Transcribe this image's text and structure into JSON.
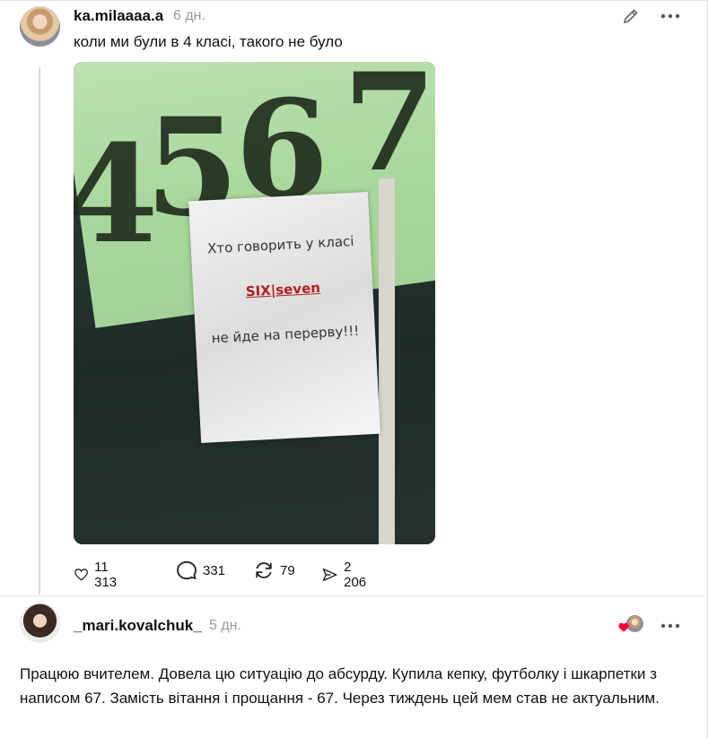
{
  "post": {
    "username": "ka.milaaaa.a",
    "time": "6 дн.",
    "text": "коли ми були в 4 класі, такого не було",
    "image": {
      "sheet_line1": "Хто говорить у класі",
      "sheet_line2": "SIX|seven",
      "sheet_line3": "не йде на перерву!!!",
      "digits": [
        "4",
        "5",
        "6",
        "7"
      ]
    },
    "stats": {
      "likes": "11 313",
      "comments": "331",
      "reposts": "79",
      "shares": "2 206"
    },
    "icons": [
      "edit-icon",
      "more-icon",
      "heart-icon",
      "comment-icon",
      "repost-icon",
      "share-icon"
    ]
  },
  "reply": {
    "username": "_mari.kovalchuk_",
    "time": "5 дн.",
    "text": "Працюю вчителем. Довела цю ситуацію до абсурду. Купила кепку, футболку і шкарпетки з написом 67. Замість вітання і прощання - 67. Через тиждень цей мем став не актуальним.",
    "like_heart_color": "#ff0034"
  }
}
